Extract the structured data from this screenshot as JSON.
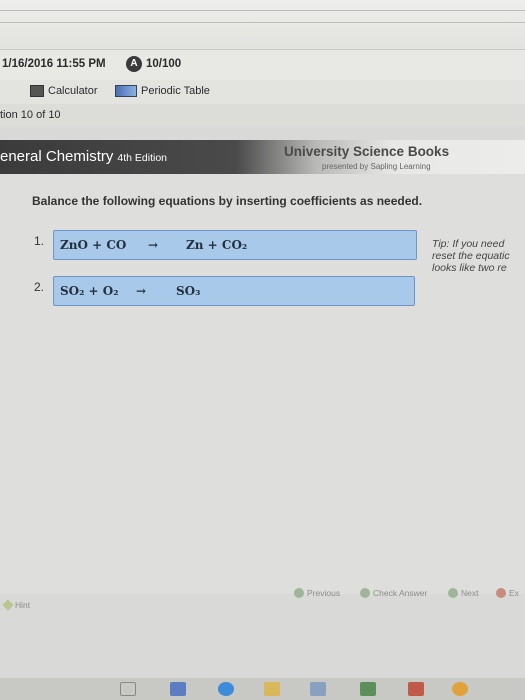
{
  "status": {
    "datetime": "1/16/2016 11:55 PM",
    "badge": "A",
    "score": "10/100"
  },
  "toolbar": {
    "calculator_label": "Calculator",
    "periodic_table_label": "Periodic Table"
  },
  "question_counter": "tion 10 of 10",
  "header": {
    "title": "eneral Chemistry",
    "edition": "4th Edition",
    "publisher": "University Science Books",
    "publisher_sub": "presented by Sapling Learning"
  },
  "main": {
    "instruction": "Balance the following equations by inserting coefficients as needed.",
    "equations": [
      {
        "number": "1.",
        "lhs": "ZnO + CO",
        "arrow": "→",
        "rhs": "Zn + CO₂"
      },
      {
        "number": "2.",
        "lhs": "SO₂ + O₂",
        "arrow": "→",
        "rhs": "SO₃"
      }
    ],
    "tip": [
      "Tip: If you need",
      "reset the equatic",
      "looks like two re"
    ]
  },
  "footer": {
    "hint_label": "Hint",
    "previous_label": "Previous",
    "check_answer_label": "Check Answer",
    "next_label": "Next",
    "exit_label": "Ex"
  },
  "colors": {
    "answer_box": "#a9c9ea",
    "answer_box_border": "#6c96c7",
    "header_dark": "#3b3b3b"
  }
}
